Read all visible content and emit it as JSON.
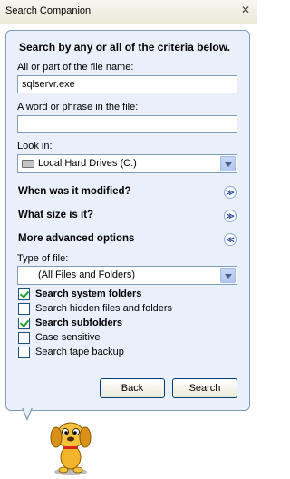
{
  "window": {
    "title": "Search Companion",
    "close_glyph": "✕"
  },
  "panel": {
    "heading": "Search by any or all of the criteria below.",
    "file_name_label": "All or part of the file name:",
    "file_name_value": "sqlservr.exe",
    "phrase_label": "A word or phrase in the file:",
    "phrase_value": "",
    "look_in_label": "Look in:",
    "look_in_value": "Local Hard Drives (C:)",
    "sections": {
      "modified": "When was it modified?",
      "size": "What size is it?",
      "advanced": "More advanced options"
    },
    "type_label": "Type of file:",
    "type_value": "(All Files and Folders)",
    "checkboxes": [
      {
        "label": "Search system folders",
        "checked": true
      },
      {
        "label": "Search hidden files and folders",
        "checked": false
      },
      {
        "label": "Search subfolders",
        "checked": true
      },
      {
        "label": "Case sensitive",
        "checked": false
      },
      {
        "label": "Search tape backup",
        "checked": false
      }
    ],
    "buttons": {
      "back": "Back",
      "search": "Search"
    }
  },
  "icons": {
    "drive": "hard-drive-icon",
    "expand": "chevron-down-double-icon",
    "collapse": "chevron-up-double-icon",
    "mascot": "search-dog-icon"
  }
}
